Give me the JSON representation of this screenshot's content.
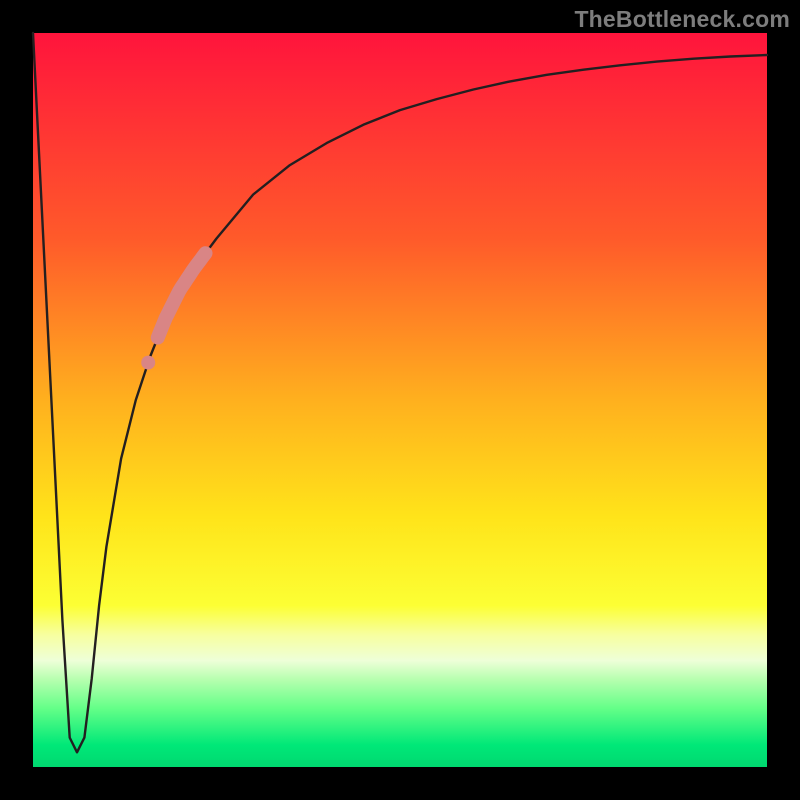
{
  "watermark": "TheBottleneck.com",
  "colors": {
    "frame": "#000000",
    "curve_stroke": "#231f20",
    "highlight_fill": "#d98585"
  },
  "chart_data": {
    "type": "line",
    "title": "",
    "xlabel": "",
    "ylabel": "",
    "xlim": [
      0,
      100
    ],
    "ylim": [
      0,
      100
    ],
    "grid": false,
    "series": [
      {
        "name": "bottleneck-curve",
        "x": [
          0,
          2,
          4,
          5,
          6,
          7,
          8,
          9,
          10,
          12,
          14,
          16,
          18,
          20,
          22,
          25,
          30,
          35,
          40,
          45,
          50,
          55,
          60,
          65,
          70,
          75,
          80,
          85,
          90,
          95,
          100
        ],
        "y": [
          100,
          60,
          20,
          4,
          2,
          4,
          12,
          22,
          30,
          42,
          50,
          56,
          61,
          65,
          68,
          72,
          78,
          82,
          85,
          87.5,
          89.5,
          91,
          92.3,
          93.4,
          94.3,
          95,
          95.6,
          96.1,
          96.5,
          96.8,
          97
        ]
      }
    ],
    "annotations": [
      {
        "name": "highlight-segment",
        "shape": "thick-segment",
        "x_range": [
          17,
          23.5
        ],
        "note": "salmon highlighted region on ascending branch"
      }
    ]
  }
}
